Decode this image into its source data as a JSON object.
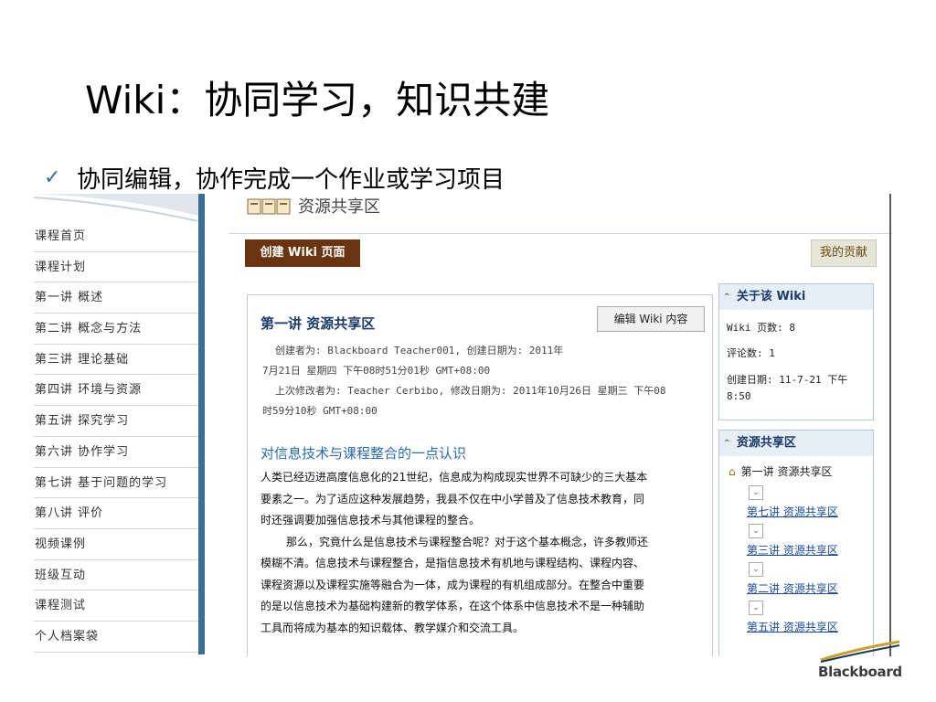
{
  "slide": {
    "title": "Wiki：协同学习，知识共建",
    "bullet": "协同编辑，协作完成一个作业或学习项目"
  },
  "left_nav": {
    "items": [
      {
        "label": "课程首页"
      },
      {
        "label": "课程计划"
      },
      {
        "label": "第一讲 概述"
      },
      {
        "label": "第二讲 概念与方法"
      },
      {
        "label": "第三讲 理论基础"
      },
      {
        "label": "第四讲 环境与资源"
      },
      {
        "label": "第五讲 探究学习"
      },
      {
        "label": "第六讲 协作学习"
      },
      {
        "label": "第七讲 基于问题的学习"
      },
      {
        "label": "第八讲 评价"
      },
      {
        "label": "视频课例"
      },
      {
        "label": "班级互动"
      },
      {
        "label": "课程测试"
      },
      {
        "label": "个人档案袋"
      }
    ]
  },
  "header": {
    "title": "资源共享区"
  },
  "toolbar": {
    "create_label": "创建 Wiki 页面",
    "contrib_label": "我的贡献"
  },
  "page": {
    "title": "第一讲 资源共享区",
    "edit_label": "编辑 Wiki 内容",
    "meta": [
      "创建者为: Blackboard Teacher001, 创建日期为: 2011年",
      "7月21日 星期四 下午08时51分01秒 GMT+08:00",
      "上次修改者为: Teacher Cerbibo, 修改日期为: 2011年10月26日 星期三 下午08",
      "时59分10秒 GMT+08:00"
    ],
    "article_title": "对信息技术与课程整合的一点认识",
    "article_lines": [
      "人类已经迈进高度信息化的21世纪，信息成为构成现实世界不可缺少的三大基本",
      "要素之一。为了适应这种发展趋势，我县不仅在中小学普及了信息技术教育，同",
      "时还强调要加强信息技术与其他课程的整合。",
      "那么，究竟什么是信息技术与课程整合呢？对于这个基本概念，许多教师还",
      "模糊不清。信息技术与课程整合，是指信息技术有机地与课程结构、课程内容、",
      "课程资源以及课程实施等融合为一体，成为课程的有机组成部分。在整合中重要",
      "的是以信息技术为基础构建新的教学体系，在这个体系中信息技术不是一种辅助",
      "工具而将成为基本的知识载体、教学媒介和交流工具。"
    ]
  },
  "about": {
    "heading": "关于该 Wiki",
    "pages": "Wiki 页数: 8",
    "comments": "评论数: 1",
    "created_l1": "创建日期: 11-7-21 下午",
    "created_l2": "8:50"
  },
  "resources": {
    "heading": "资源共享区",
    "first": "第一讲 资源共享区",
    "links": [
      "第七讲 资源共享区",
      "第三讲 资源共享区",
      "第二讲 资源共享区",
      "第五讲 资源共享区"
    ]
  },
  "brand": {
    "logo_text": "Blackboard"
  },
  "colors": {
    "nav_bar": "#3a6e95",
    "create_button": "#6b3410",
    "link": "#1a4a9a"
  }
}
